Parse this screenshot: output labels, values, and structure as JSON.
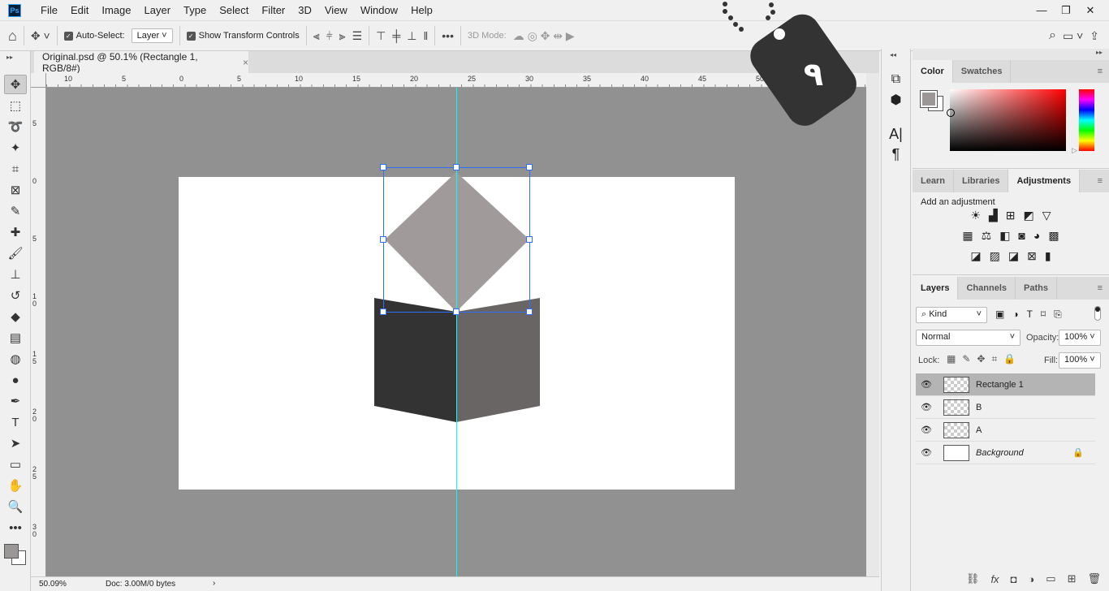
{
  "app": {
    "logo": "Ps"
  },
  "menu": [
    "File",
    "Edit",
    "Image",
    "Layer",
    "Type",
    "Select",
    "Filter",
    "3D",
    "View",
    "Window",
    "Help"
  ],
  "window_controls": {
    "minimize": "—",
    "restore": "❐",
    "close": "✕"
  },
  "options": {
    "auto_select_label": "Auto-Select:",
    "auto_select_checked": true,
    "auto_select_value": "Layer",
    "show_transform_label": "Show Transform Controls",
    "show_transform_checked": true,
    "more": "•••",
    "mode_3d_label": "3D Mode:"
  },
  "document_tab": {
    "title": "Original.psd @ 50.1% (Rectangle 1, RGB/8#)",
    "close": "×"
  },
  "ruler_top": [
    "10",
    "5",
    "0",
    "5",
    "10",
    "15",
    "20",
    "25",
    "30",
    "35",
    "40",
    "45",
    "50"
  ],
  "ruler_left": [
    "5",
    "0",
    "5",
    "1 0",
    "1 5",
    "2 0",
    "2 5",
    "3 0"
  ],
  "status": {
    "zoom": "50.09%",
    "doc": "Doc: 3.00M/0 bytes",
    "arrow": "›"
  },
  "watermark": {
    "text": "٩",
    "color": "#333333"
  },
  "color_panel": {
    "tabs": [
      "Color",
      "Swatches"
    ],
    "active": "Color",
    "foreground": "#9b9797",
    "background": "#ffffff",
    "hue": "#ff0000"
  },
  "adjustments_panel": {
    "tabs": [
      "Learn",
      "Libraries",
      "Adjustments"
    ],
    "active": "Adjustments",
    "heading": "Add an adjustment"
  },
  "layers_panel": {
    "tabs": [
      "Layers",
      "Channels",
      "Paths"
    ],
    "active": "Layers",
    "filter_label": "Kind",
    "blend_mode": "Normal",
    "opacity_label": "Opacity:",
    "opacity": "100%",
    "lock_label": "Lock:",
    "fill_label": "Fill:",
    "fill": "100%",
    "layers": [
      {
        "name": "Rectangle 1",
        "selected": true,
        "visible": true
      },
      {
        "name": "B",
        "selected": false,
        "visible": true
      },
      {
        "name": "A",
        "selected": false,
        "visible": true
      },
      {
        "name": "Background",
        "selected": false,
        "visible": true,
        "locked": true
      }
    ]
  },
  "artwork_colors": {
    "diamond": "#a09b9a",
    "left_page": "#333333",
    "right_page": "#6a6565",
    "guide": "#00ffff",
    "selection": "#2f6fff"
  }
}
